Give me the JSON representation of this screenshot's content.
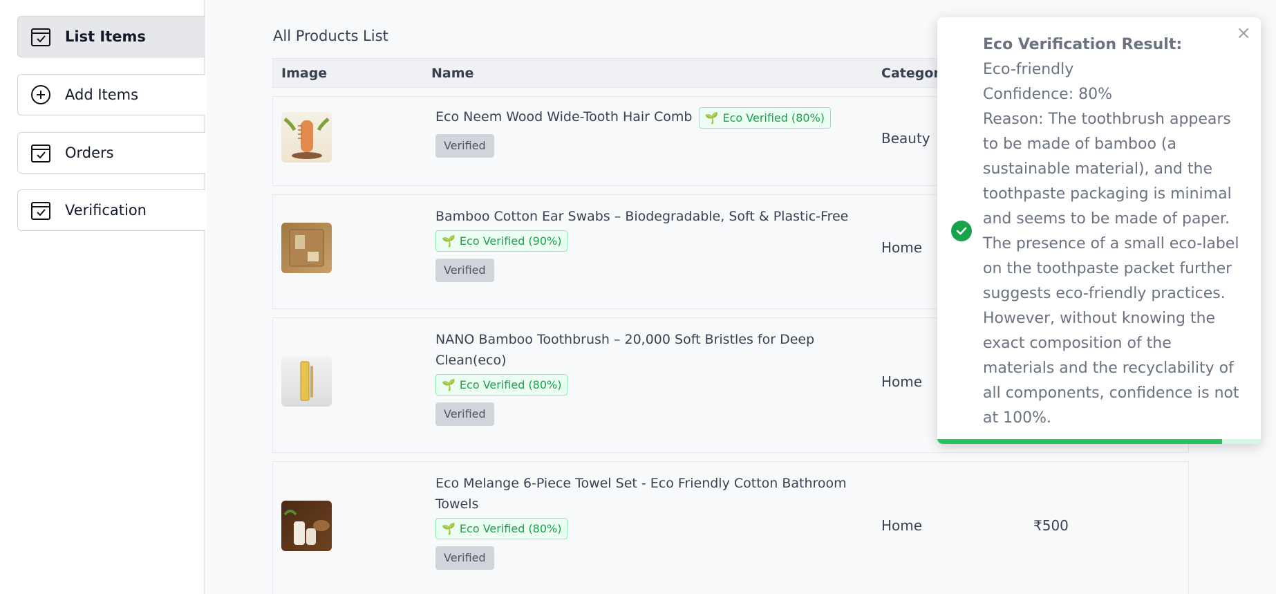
{
  "sidebar": {
    "items": [
      {
        "label": "List Items",
        "icon": "calendar-check-icon",
        "active": true
      },
      {
        "label": "Add Items",
        "icon": "plus-circle-icon",
        "active": false
      },
      {
        "label": "Orders",
        "icon": "calendar-check-icon",
        "active": false
      },
      {
        "label": "Verification",
        "icon": "calendar-check-icon",
        "active": false
      }
    ]
  },
  "main": {
    "title": "All Products List",
    "columns": {
      "image": "Image",
      "name": "Name",
      "category": "Categor"
    },
    "rows": [
      {
        "name": "Eco Neem Wood Wide-Tooth Hair Comb",
        "eco_badge": "Eco Verified (80%)",
        "status": "Verified",
        "category": "Beauty",
        "price": "",
        "image": "comb-image"
      },
      {
        "name": "Bamboo Cotton Ear Swabs – Biodegradable, Soft & Plastic-Free",
        "eco_badge": "Eco Verified (90%)",
        "status": "Verified",
        "category": "Home",
        "price": "",
        "image": "ear-swabs-image"
      },
      {
        "name": "NANO Bamboo Toothbrush – 20,000 Soft Bristles for Deep Clean(eco)",
        "eco_badge": "Eco Verified (80%)",
        "status": "Verified",
        "category": "Home",
        "price": "",
        "image": "toothbrush-image"
      },
      {
        "name": "Eco Melange 6-Piece Towel Set - Eco Friendly Cotton Bathroom Towels",
        "eco_badge": "Eco Verified (80%)",
        "status": "Verified",
        "category": "Home",
        "price": "₹500",
        "image": "towel-image"
      }
    ]
  },
  "toast": {
    "title": "Eco Verification Result:",
    "result": "Eco-friendly",
    "confidence": "Confidence: 80%",
    "reason": "Reason: The toothbrush appears to be made of bamboo (a sustainable material), and the toothpaste packaging is minimal and seems to be made of paper. The presence of a small eco-label on the toothpaste packet further suggests eco-friendly practices. However, without knowing the exact composition of the materials and the recyclability of all components, confidence is not at 100%.",
    "close": "×",
    "progress": 0.88
  },
  "colors": {
    "accent_green": "#22c55e",
    "badge_green": "#16a34a",
    "active_nav": "#e5e7eb"
  }
}
